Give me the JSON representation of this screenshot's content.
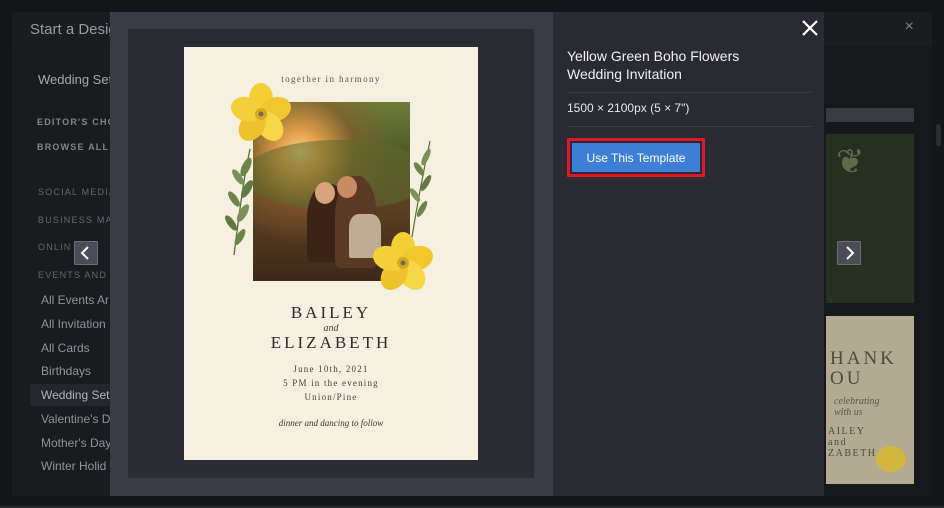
{
  "app": {
    "title": "Start a Desig",
    "close_symbol": "×",
    "sidebar": {
      "header": "Wedding Set",
      "editors_choice": "EDITOR'S CHOI",
      "browse_all": "BROWSE ALL T",
      "sections": [
        "SOCIAL MEDIA",
        "BUSINESS MAR",
        "ONLIN",
        "EVENTS AND C"
      ],
      "items": [
        "All Events Ar",
        "All Invitation",
        "All Cards",
        "Birthdays",
        "Wedding Set",
        "Valentine's D",
        "Mother's Day",
        "Winter Holid"
      ],
      "active_index": 4
    },
    "background_cards": {
      "card2_line1": "HANK",
      "card2_line2": "OU",
      "card2_script": "celebrating\nwith us",
      "card2_line3": "AILEY\nand\nZABETH"
    }
  },
  "modal": {
    "title": "Yellow Green Boho Flowers Wedding Invitation",
    "size": "1500 × 2100px (5 × 7\")",
    "use_button_label": "Use This Template",
    "close_icon": "close-icon",
    "prev_icon": "chevron-left-icon",
    "next_icon": "chevron-right-icon",
    "highlight_color": "#e0152a",
    "button_color": "#3d7fd6"
  },
  "invitation": {
    "tagline": "together in harmony",
    "name1": "BAILEY",
    "and": "and",
    "name2": "ELIZABETH",
    "date": "June 10th, 2021",
    "time": "5 PM in the evening",
    "place": "Union/Pine",
    "footer": "dinner and dancing to follow"
  }
}
